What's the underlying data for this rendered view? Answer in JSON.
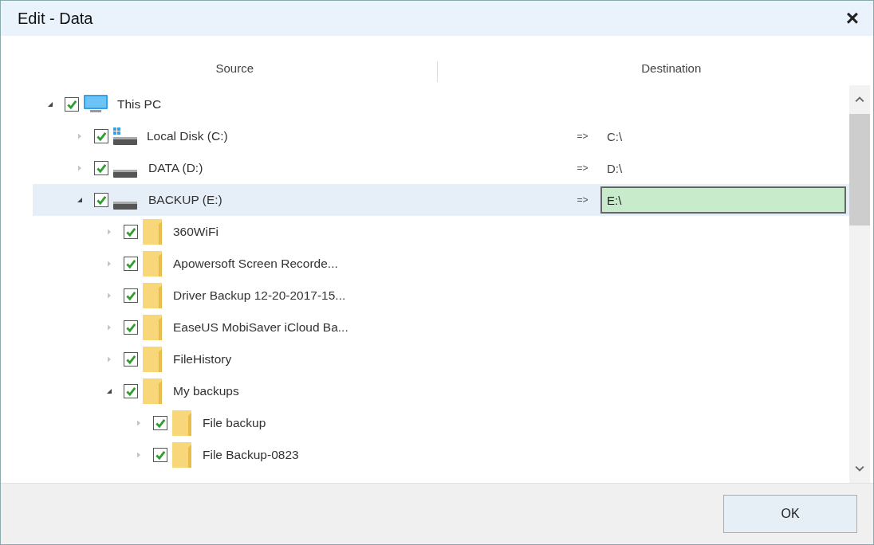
{
  "window": {
    "title": "Edit - Data",
    "close": "×"
  },
  "columns": [
    "Source",
    "Destination"
  ],
  "tree": [
    {
      "label": "This PC",
      "kind": "computer",
      "checked": true,
      "expanded": true,
      "selected": false,
      "children": [
        {
          "label": "Local Disk (C:)",
          "kind": "system-drive",
          "checked": true,
          "expanded": false,
          "selected": false,
          "destination": {
            "arrow": "=>",
            "value": "C:\\",
            "editing": false
          }
        },
        {
          "label": "DATA (D:)",
          "kind": "drive",
          "checked": true,
          "expanded": false,
          "selected": false,
          "destination": {
            "arrow": "=>",
            "value": "D:\\",
            "editing": false
          }
        },
        {
          "label": "BACKUP (E:)",
          "kind": "drive",
          "checked": true,
          "expanded": true,
          "selected": true,
          "destination": {
            "arrow": "=>",
            "value": "E:\\",
            "editing": true
          },
          "children": [
            {
              "label": "360WiFi",
              "kind": "folder",
              "checked": true,
              "expanded": false,
              "selected": false
            },
            {
              "label": "Apowersoft Screen Recorde...",
              "kind": "folder",
              "checked": true,
              "expanded": false,
              "selected": false
            },
            {
              "label": "Driver Backup 12-20-2017-15...",
              "kind": "folder",
              "checked": true,
              "expanded": false,
              "selected": false
            },
            {
              "label": "EaseUS MobiSaver iCloud Ba...",
              "kind": "folder",
              "checked": true,
              "expanded": false,
              "selected": false
            },
            {
              "label": "FileHistory",
              "kind": "folder",
              "checked": true,
              "expanded": false,
              "selected": false
            },
            {
              "label": "My backups",
              "kind": "folder",
              "checked": true,
              "expanded": true,
              "selected": false,
              "children": [
                {
                  "label": "File backup",
                  "kind": "folder",
                  "checked": true,
                  "expanded": false,
                  "selected": false
                },
                {
                  "label": "File Backup-0823",
                  "kind": "folder",
                  "checked": true,
                  "expanded": false,
                  "selected": false
                }
              ]
            }
          ]
        }
      ]
    }
  ],
  "buttons": [
    "OK"
  ]
}
